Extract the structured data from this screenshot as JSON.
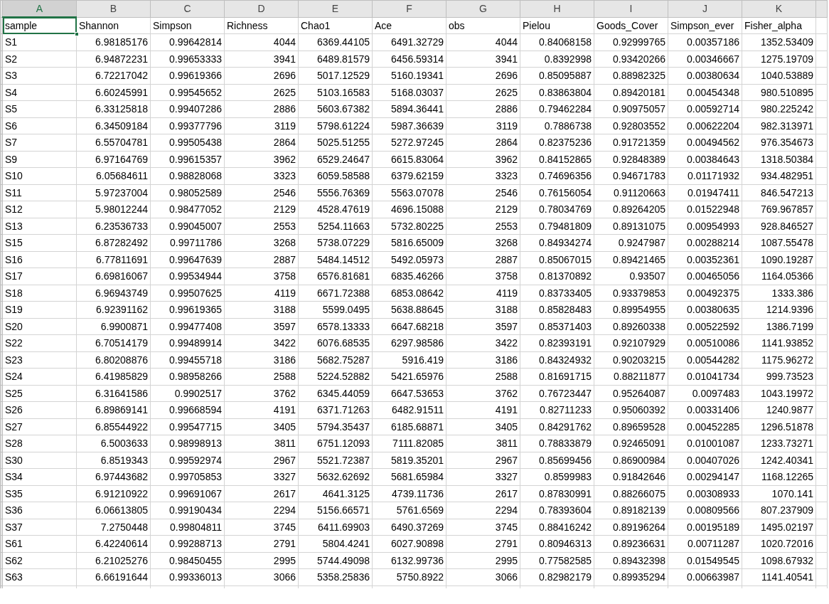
{
  "column_headers": [
    {
      "label": "A",
      "selected": true
    },
    {
      "label": "B",
      "selected": false
    },
    {
      "label": "C",
      "selected": false
    },
    {
      "label": "D",
      "selected": false
    },
    {
      "label": "E",
      "selected": false
    },
    {
      "label": "F",
      "selected": false
    },
    {
      "label": "G",
      "selected": false
    },
    {
      "label": "H",
      "selected": false
    },
    {
      "label": "I",
      "selected": false
    },
    {
      "label": "J",
      "selected": false
    },
    {
      "label": "K",
      "selected": false
    }
  ],
  "header_row": [
    {
      "text": "sample",
      "selected": true
    },
    {
      "text": "Shannon",
      "selected": false
    },
    {
      "text": "Simpson",
      "selected": false
    },
    {
      "text": "Richness",
      "selected": false
    },
    {
      "text": "Chao1",
      "selected": false
    },
    {
      "text": "Ace",
      "selected": false
    },
    {
      "text": "obs",
      "selected": false
    },
    {
      "text": "Pielou",
      "selected": false
    },
    {
      "text": "Goods_Cover",
      "selected": false
    },
    {
      "text": "Simpson_ever",
      "selected": false
    },
    {
      "text": "Fisher_alpha",
      "selected": false
    }
  ],
  "rows": [
    [
      "S1",
      "6.98185176",
      "0.99642814",
      "4044",
      "6369.44105",
      "6491.32729",
      "4044",
      "0.84068158",
      "0.92999765",
      "0.00357186",
      "1352.53409"
    ],
    [
      "S2",
      "6.94872231",
      "0.99653333",
      "3941",
      "6489.81579",
      "6456.59314",
      "3941",
      "0.8392998",
      "0.93420266",
      "0.00346667",
      "1275.19709"
    ],
    [
      "S3",
      "6.72217042",
      "0.99619366",
      "2696",
      "5017.12529",
      "5160.19341",
      "2696",
      "0.85095887",
      "0.88982325",
      "0.00380634",
      "1040.53889"
    ],
    [
      "S4",
      "6.60245991",
      "0.99545652",
      "2625",
      "5103.16583",
      "5168.03037",
      "2625",
      "0.83863804",
      "0.89420181",
      "0.00454348",
      "980.510895"
    ],
    [
      "S5",
      "6.33125818",
      "0.99407286",
      "2886",
      "5603.67382",
      "5894.36441",
      "2886",
      "0.79462284",
      "0.90975057",
      "0.00592714",
      "980.225242"
    ],
    [
      "S6",
      "6.34509184",
      "0.99377796",
      "3119",
      "5798.61224",
      "5987.36639",
      "3119",
      "0.7886738",
      "0.92803552",
      "0.00622204",
      "982.313971"
    ],
    [
      "S7",
      "6.55704781",
      "0.99505438",
      "2864",
      "5025.51255",
      "5272.97245",
      "2864",
      "0.82375236",
      "0.91721359",
      "0.00494562",
      "976.354673"
    ],
    [
      "S9",
      "6.97164769",
      "0.99615357",
      "3962",
      "6529.24647",
      "6615.83064",
      "3962",
      "0.84152865",
      "0.92848389",
      "0.00384643",
      "1318.50384"
    ],
    [
      "S10",
      "6.05684611",
      "0.98828068",
      "3323",
      "6059.58588",
      "6379.62159",
      "3323",
      "0.74696356",
      "0.94671783",
      "0.01171932",
      "934.482951"
    ],
    [
      "S11",
      "5.97237004",
      "0.98052589",
      "2546",
      "5556.76369",
      "5563.07078",
      "2546",
      "0.76156054",
      "0.91120663",
      "0.01947411",
      "846.547213"
    ],
    [
      "S12",
      "5.98012244",
      "0.98477052",
      "2129",
      "4528.47619",
      "4696.15088",
      "2129",
      "0.78034769",
      "0.89264205",
      "0.01522948",
      "769.967857"
    ],
    [
      "S13",
      "6.23536733",
      "0.99045007",
      "2553",
      "5254.11663",
      "5732.80225",
      "2553",
      "0.79481809",
      "0.89131075",
      "0.00954993",
      "928.846527"
    ],
    [
      "S15",
      "6.87282492",
      "0.99711786",
      "3268",
      "5738.07229",
      "5816.65009",
      "3268",
      "0.84934274",
      "0.9247987",
      "0.00288214",
      "1087.55478"
    ],
    [
      "S16",
      "6.77811691",
      "0.99647639",
      "2887",
      "5484.14512",
      "5492.05973",
      "2887",
      "0.85067015",
      "0.89421465",
      "0.00352361",
      "1090.19287"
    ],
    [
      "S17",
      "6.69816067",
      "0.99534944",
      "3758",
      "6576.81681",
      "6835.46266",
      "3758",
      "0.81370892",
      "0.93507",
      "0.00465056",
      "1164.05366"
    ],
    [
      "S18",
      "6.96943749",
      "0.99507625",
      "4119",
      "6671.72388",
      "6853.08642",
      "4119",
      "0.83733405",
      "0.93379853",
      "0.00492375",
      "1333.386"
    ],
    [
      "S19",
      "6.92391162",
      "0.99619365",
      "3188",
      "5599.0495",
      "5638.88645",
      "3188",
      "0.85828483",
      "0.89954955",
      "0.00380635",
      "1214.9396"
    ],
    [
      "S20",
      "6.9900871",
      "0.99477408",
      "3597",
      "6578.13333",
      "6647.68218",
      "3597",
      "0.85371403",
      "0.89260338",
      "0.00522592",
      "1386.7199"
    ],
    [
      "S22",
      "6.70514179",
      "0.99489914",
      "3422",
      "6076.68535",
      "6297.98586",
      "3422",
      "0.82393191",
      "0.92107929",
      "0.00510086",
      "1141.93852"
    ],
    [
      "S23",
      "6.80208876",
      "0.99455718",
      "3186",
      "5682.75287",
      "5916.419",
      "3186",
      "0.84324932",
      "0.90203215",
      "0.00544282",
      "1175.96272"
    ],
    [
      "S24",
      "6.41985829",
      "0.98958266",
      "2588",
      "5224.52882",
      "5421.65976",
      "2588",
      "0.81691715",
      "0.88211877",
      "0.01041734",
      "999.73523"
    ],
    [
      "S25",
      "6.31641586",
      "0.9902517",
      "3762",
      "6345.44059",
      "6647.53653",
      "3762",
      "0.76723447",
      "0.95264087",
      "0.0097483",
      "1043.19972"
    ],
    [
      "S26",
      "6.89869141",
      "0.99668594",
      "4191",
      "6371.71263",
      "6482.91511",
      "4191",
      "0.82711233",
      "0.95060392",
      "0.00331406",
      "1240.9877"
    ],
    [
      "S27",
      "6.85544922",
      "0.99547715",
      "3405",
      "5794.35437",
      "6185.68871",
      "3405",
      "0.84291762",
      "0.89659528",
      "0.00452285",
      "1296.51878"
    ],
    [
      "S28",
      "6.5003633",
      "0.98998913",
      "3811",
      "6751.12093",
      "7111.82085",
      "3811",
      "0.78833879",
      "0.92465091",
      "0.01001087",
      "1233.73271"
    ],
    [
      "S30",
      "6.8519343",
      "0.99592974",
      "2967",
      "5521.72387",
      "5819.35201",
      "2967",
      "0.85699456",
      "0.86900984",
      "0.00407026",
      "1242.40341"
    ],
    [
      "S34",
      "6.97443682",
      "0.99705853",
      "3327",
      "5632.62692",
      "5681.65984",
      "3327",
      "0.8599983",
      "0.91842646",
      "0.00294147",
      "1168.12265"
    ],
    [
      "S35",
      "6.91210922",
      "0.99691067",
      "2617",
      "4641.3125",
      "4739.11736",
      "2617",
      "0.87830991",
      "0.88266075",
      "0.00308933",
      "1070.141"
    ],
    [
      "S36",
      "6.06613805",
      "0.99190434",
      "2294",
      "5156.66571",
      "5761.6569",
      "2294",
      "0.78393604",
      "0.89182139",
      "0.00809566",
      "807.237909"
    ],
    [
      "S37",
      "7.2750448",
      "0.99804811",
      "3745",
      "6411.69903",
      "6490.37269",
      "3745",
      "0.88416242",
      "0.89196264",
      "0.00195189",
      "1495.02197"
    ],
    [
      "S61",
      "6.42240614",
      "0.99288713",
      "2791",
      "5804.4241",
      "6027.90898",
      "2791",
      "0.80946313",
      "0.89236631",
      "0.00711287",
      "1020.72016"
    ],
    [
      "S62",
      "6.21025276",
      "0.98450455",
      "2995",
      "5744.49098",
      "6132.99736",
      "2995",
      "0.77582585",
      "0.89432398",
      "0.01549545",
      "1098.67932"
    ],
    [
      "S63",
      "6.66191644",
      "0.99336013",
      "3066",
      "5358.25836",
      "5750.8922",
      "3066",
      "0.82982179",
      "0.89935294",
      "0.00663987",
      "1141.40541"
    ]
  ]
}
